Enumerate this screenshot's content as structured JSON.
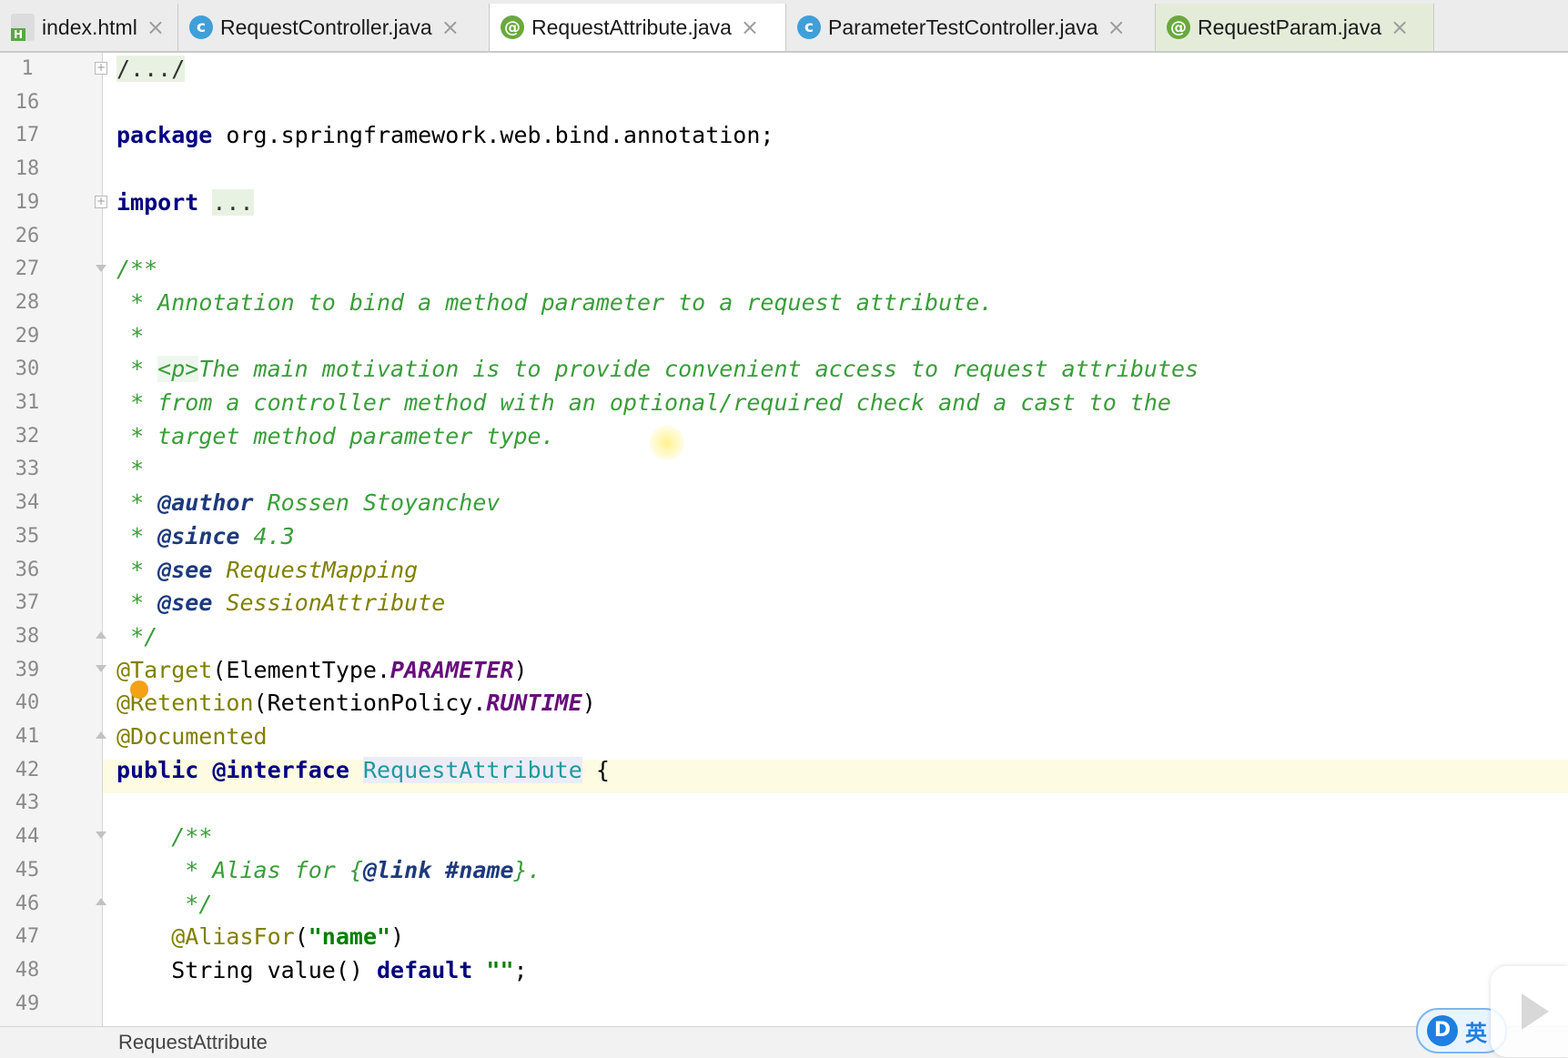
{
  "tabs": [
    {
      "label": "index.html",
      "icon": "html-file-icon",
      "active": false
    },
    {
      "label": "RequestController.java",
      "icon": "class-icon",
      "active": false
    },
    {
      "label": "RequestAttribute.java",
      "icon": "annotation-icon",
      "active": true
    },
    {
      "label": "ParameterTestController.java",
      "icon": "class-icon",
      "active": false
    },
    {
      "label": "RequestParam.java",
      "icon": "annotation-icon",
      "active": false
    }
  ],
  "icon_glyphs": {
    "class": "c",
    "annotation": "@",
    "close": "×"
  },
  "code": {
    "lines": [
      {
        "num": "1",
        "text": "/.../"
      },
      {
        "num": "16",
        "text": ""
      },
      {
        "num": "17",
        "text": "package org.springframework.web.bind.annotation;"
      },
      {
        "num": "18",
        "text": ""
      },
      {
        "num": "19",
        "text": "import ..."
      },
      {
        "num": "26",
        "text": ""
      },
      {
        "num": "27",
        "text": "/**"
      },
      {
        "num": "28",
        "text": " * Annotation to bind a method parameter to a request attribute."
      },
      {
        "num": "29",
        "text": " *"
      },
      {
        "num": "30",
        "text": " * <p>The main motivation is to provide convenient access to request attributes"
      },
      {
        "num": "31",
        "text": " * from a controller method with an optional/required check and a cast to the"
      },
      {
        "num": "32",
        "text": " * target method parameter type."
      },
      {
        "num": "33",
        "text": " *"
      },
      {
        "num": "34",
        "text": " * @author Rossen Stoyanchev"
      },
      {
        "num": "35",
        "text": " * @since 4.3"
      },
      {
        "num": "36",
        "text": " * @see RequestMapping"
      },
      {
        "num": "37",
        "text": " * @see SessionAttribute"
      },
      {
        "num": "38",
        "text": " */"
      },
      {
        "num": "39",
        "text": "@Target(ElementType.PARAMETER)"
      },
      {
        "num": "40",
        "text": "@Retention(RetentionPolicy.RUNTIME)"
      },
      {
        "num": "41",
        "text": "@Documented"
      },
      {
        "num": "42",
        "text": "public @interface RequestAttribute {"
      },
      {
        "num": "43",
        "text": ""
      },
      {
        "num": "44",
        "text": "    /**"
      },
      {
        "num": "45",
        "text": "     * Alias for {@link #name}."
      },
      {
        "num": "46",
        "text": "     */"
      },
      {
        "num": "47",
        "text": "    @AliasFor(\"name\")"
      },
      {
        "num": "48",
        "text": "    String value() default \"\";"
      },
      {
        "num": "49",
        "text": ""
      }
    ],
    "current_line": "42"
  },
  "status": {
    "breadcrumb": "RequestAttribute"
  },
  "overlay": {
    "icon_glyph": "D",
    "text": "英"
  },
  "colors": {
    "keyword": "#000080",
    "annotation": "#808000",
    "comment": "#3a9d3a",
    "string": "#008000",
    "constant": "#660e7a",
    "current_line_bg": "#fdfbe2"
  }
}
